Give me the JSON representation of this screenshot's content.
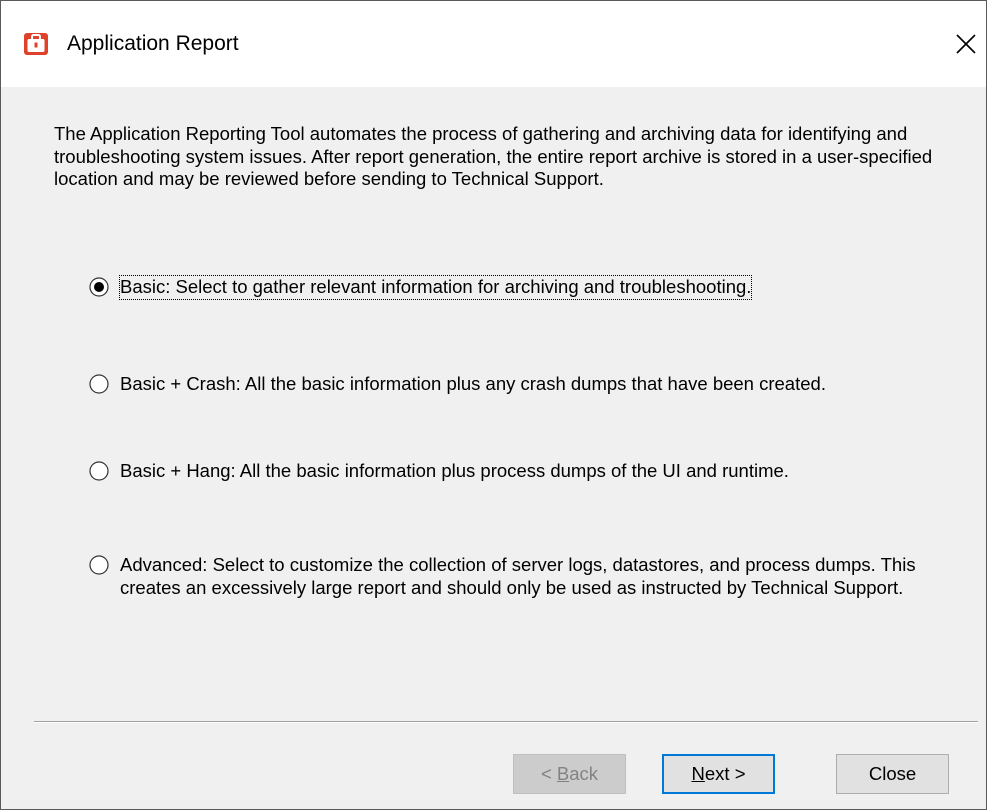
{
  "window": {
    "title": "Application Report",
    "app_icon": "toolbox-icon",
    "brand_color": "#e0412b",
    "close_icon": "close-icon"
  },
  "intro": {
    "text": "The Application Reporting Tool automates the process of gathering and archiving data for identifying and troubleshooting system issues. After report generation, the entire report archive is stored in a user-specified location and may be reviewed before sending to Technical Support."
  },
  "options": [
    {
      "label": "Basic:  Select to gather relevant information for archiving and troubleshooting.",
      "selected": true
    },
    {
      "label": "Basic + Crash:  All the basic information plus any crash dumps that have been created.",
      "selected": false
    },
    {
      "label": "Basic + Hang:  All the basic information plus process dumps of the UI and runtime.",
      "selected": false
    },
    {
      "label": "Advanced:  Select to customize the collection of server logs, datastores, and process dumps. This creates an excessively large report and should only be used as instructed by Technical Support.",
      "selected": false
    }
  ],
  "buttons": {
    "back": {
      "pre": "< ",
      "accel": "B",
      "post": "ack",
      "enabled": false
    },
    "next": {
      "accel": "N",
      "post": "ext >",
      "enabled": true,
      "default": true
    },
    "close": {
      "label": "Close",
      "enabled": true
    }
  },
  "colors": {
    "dialog_bg": "#f0f0f0",
    "focus_border": "#0078d7"
  }
}
